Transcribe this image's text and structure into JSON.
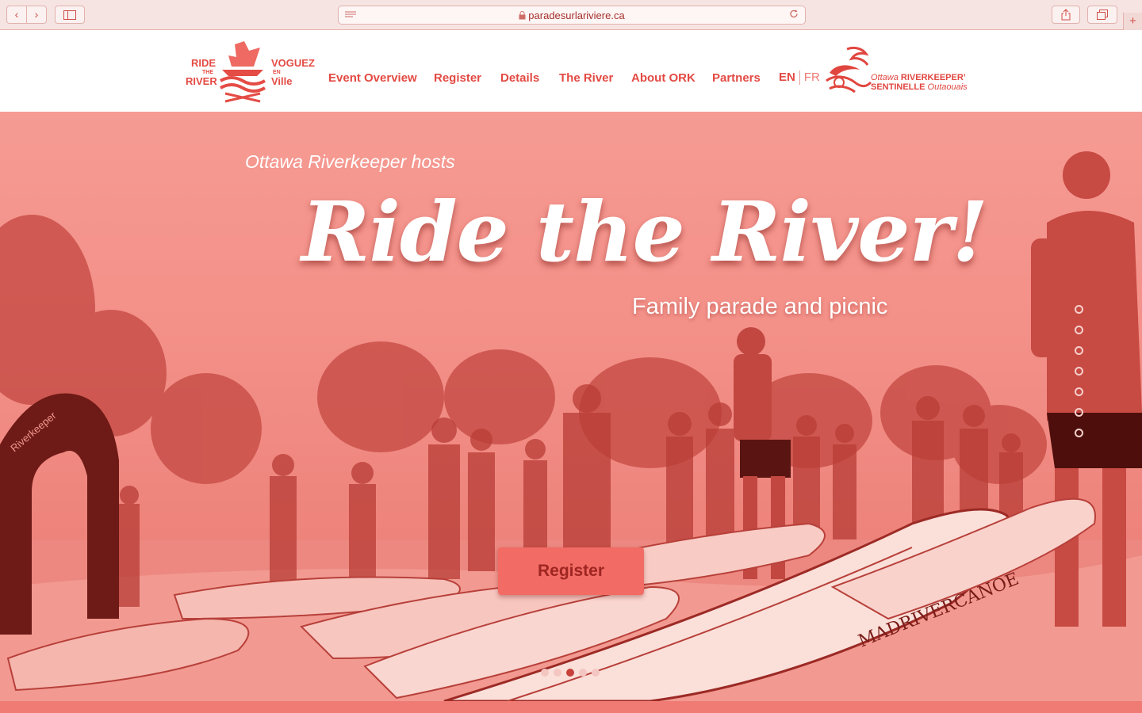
{
  "browser": {
    "url": "paradesurlariviere.ca",
    "back_icon": "‹",
    "forward_icon": "›",
    "plus_label": "+"
  },
  "logo": {
    "left_top": "RIDE",
    "left_small": "THE",
    "left_bottom": "RIVER",
    "right_top": "VOGUEZ",
    "right_small": "EN",
    "right_bottom": "Ville"
  },
  "nav": {
    "items": [
      {
        "label": "Event Overview"
      },
      {
        "label": "Register"
      },
      {
        "label": "Details"
      },
      {
        "label": "The River"
      },
      {
        "label": "About ORK"
      },
      {
        "label": "Partners"
      }
    ],
    "lang_en": "EN",
    "lang_fr": "FR"
  },
  "partner_logo": {
    "line1_italic": "Ottawa",
    "line1_bold": "RIVERKEEPER’",
    "line2_bold": "SENTINELLE",
    "line2_italic": "Outaouais"
  },
  "hero": {
    "kicker": "Ottawa Riverkeeper hosts",
    "headline": "Ride the River!",
    "subhead": "Family parade and picnic",
    "cta_label": "Register",
    "canoe_text": "MADRIVERCANOE",
    "inflatable_text": "Riverkeeper",
    "slide_count": 5,
    "active_slide": 3,
    "vertical_nav_count": 7
  },
  "colors": {
    "brand_red": "#e34a43",
    "hero_tint": "#f4928a",
    "button": "#f26b64"
  }
}
